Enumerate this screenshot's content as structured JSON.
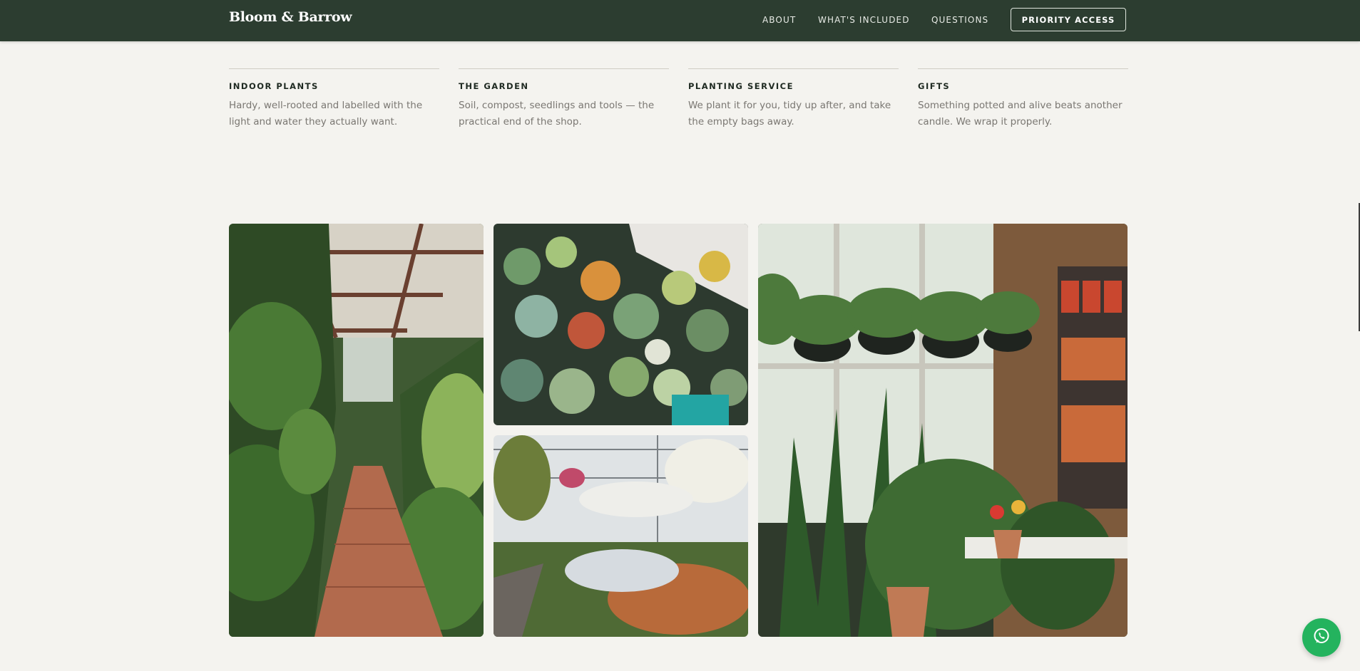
{
  "header": {
    "logo": "Bloom & Barrow",
    "nav": [
      "ABOUT",
      "WHAT'S INCLUDED",
      "QUESTIONS"
    ],
    "cta": "PRIORITY ACCESS"
  },
  "features": [
    {
      "title": "INDOOR PLANTS",
      "description": "Hardy, well-rooted and labelled with the light and water they actually want."
    },
    {
      "title": "THE GARDEN",
      "description": "Soil, compost, seedlings and tools — the practical end of the shop."
    },
    {
      "title": "PLANTING SERVICE",
      "description": "We plant it for you, tidy up after, and take the empty bags away."
    },
    {
      "title": "GIFTS",
      "description": "Something potted and alive beats another candle. We wrap it properly."
    }
  ],
  "gallery": [
    {
      "icon": "greenhouse-aisle-photo"
    },
    {
      "icon": "succulents-photo"
    },
    {
      "icon": "flower-greenhouse-photo"
    },
    {
      "icon": "hanging-plants-shop-photo"
    }
  ],
  "colors": {
    "header_bg": "#2c3d30",
    "page_bg": "#f4f3ef",
    "whatsapp": "#24b35e"
  },
  "floating": {
    "icon": "whatsapp-icon"
  }
}
